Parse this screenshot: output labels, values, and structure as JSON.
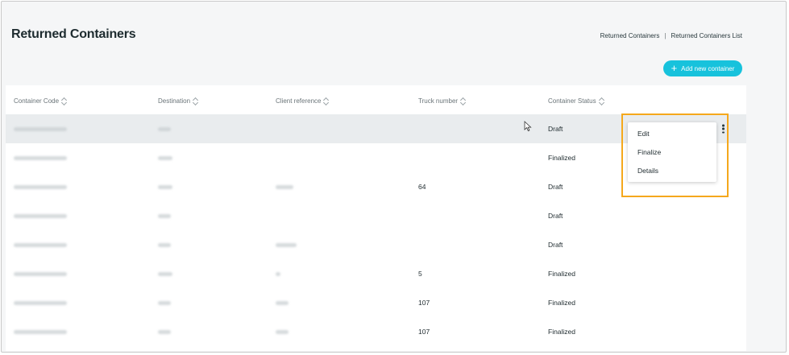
{
  "page": {
    "title": "Returned Containers"
  },
  "breadcrumb": {
    "items": [
      "Returned Containers",
      "Returned Containers List"
    ],
    "separator": "|"
  },
  "actions": {
    "add_label": "Add new container",
    "add_icon": "plus-icon",
    "accent": "#17c2dc"
  },
  "table": {
    "columns": [
      "Container Code",
      "Destination",
      "Client reference",
      "Truck number",
      "Container Status"
    ],
    "rows": [
      {
        "truck": "",
        "status": "Draft"
      },
      {
        "truck": "",
        "status": "Finalized"
      },
      {
        "truck": "64",
        "status": "Draft"
      },
      {
        "truck": "",
        "status": "Draft"
      },
      {
        "truck": "",
        "status": "Draft"
      },
      {
        "truck": "5",
        "status": "Finalized"
      },
      {
        "truck": "107",
        "status": "Finalized"
      },
      {
        "truck": "107",
        "status": "Finalized"
      }
    ]
  },
  "row_menu": {
    "items": [
      "Edit",
      "Finalize",
      "Details"
    ],
    "highlight_color": "#f5a81c"
  }
}
